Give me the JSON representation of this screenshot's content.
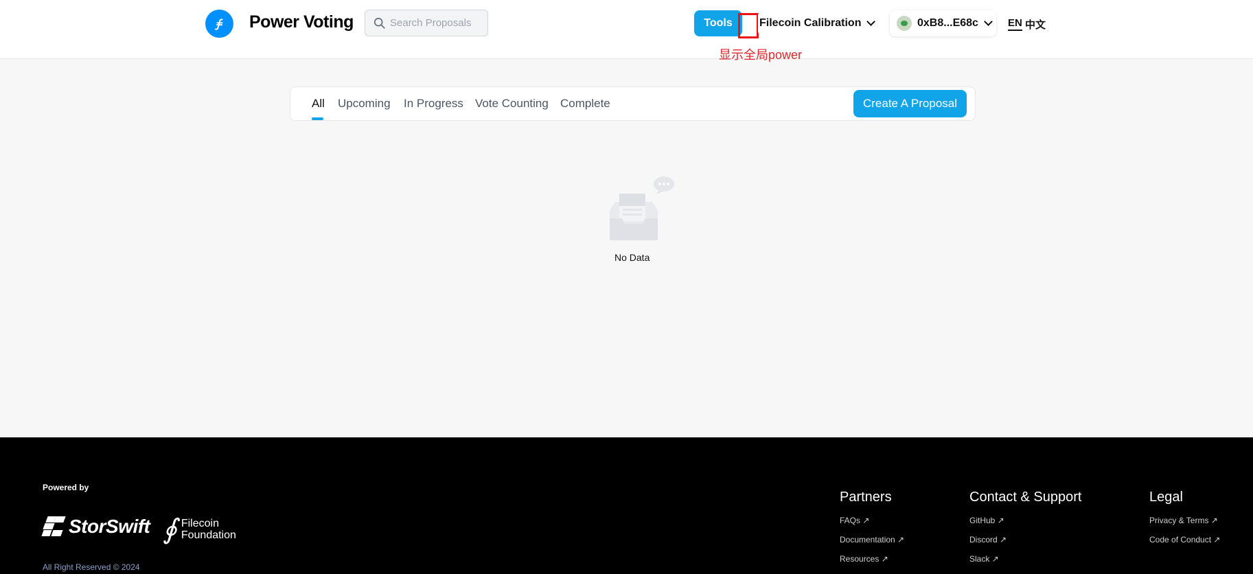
{
  "header": {
    "brand": "Power Voting",
    "search_placeholder": "Search Proposals",
    "tools_label": "Tools",
    "annotation": "显示全局power",
    "network_label": "Filecoin Calibration",
    "wallet_label": "0xB8...E68c",
    "lang_en": "EN",
    "lang_zh": "中文"
  },
  "tabs": [
    {
      "label": "All"
    },
    {
      "label": "Upcoming"
    },
    {
      "label": "In Progress"
    },
    {
      "label": "Vote Counting"
    },
    {
      "label": "Complete"
    }
  ],
  "create_label": "Create A Proposal",
  "empty": {
    "text": "No Data"
  },
  "footer": {
    "powered_by": "Powered by",
    "storswift": "StorSwift",
    "filecoin_foundation_line1": "Filecoin",
    "filecoin_foundation_line2": "Foundation",
    "rights": "All Right Reserved © 2024",
    "columns": [
      {
        "heading": "Partners",
        "links": [
          "FAQs ↗",
          "Documentation ↗",
          "Resources ↗"
        ]
      },
      {
        "heading": "Contact & Support",
        "links": [
          "GitHub ↗",
          "Discord ↗",
          "Slack ↗"
        ]
      },
      {
        "heading": "Legal",
        "links": [
          "Privacy & Terms ↗",
          "Code of Conduct ↗"
        ]
      }
    ]
  },
  "colors": {
    "accent": "#12a4e8",
    "annotation": "#e0262b",
    "logo": "#0090ff"
  }
}
